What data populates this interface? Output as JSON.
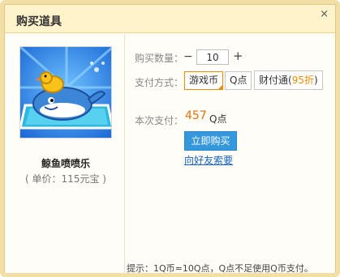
{
  "dialog": {
    "title": "购买道具",
    "close_icon": "close-icon",
    "close_glyph": "×"
  },
  "item": {
    "name": "鲸鱼喷喷乐",
    "price": "( 单价：115元宝 )",
    "image_icon": "whale-duck-image"
  },
  "form": {
    "quantity_label": "购买数量：",
    "quantity_value": "10",
    "minus_glyph": "−",
    "plus_glyph": "+",
    "payment_label": "支付方式：",
    "payment_options": [
      {
        "label": "游戏币",
        "selected": true
      },
      {
        "label": "Q点",
        "selected": false
      },
      {
        "label_prefix": "财付通(",
        "discount": "95折",
        "label_suffix": ")",
        "selected": false
      }
    ],
    "total_label": "本次支付：",
    "total_value": "457",
    "total_unit": "Q点",
    "buy_button": "立即购买",
    "ask_friend_link": "向好友索要"
  },
  "tip": "提示：1Q币=10Q点，Q点不足使用Q币支付。",
  "colors": {
    "accent_orange": "#f28b00",
    "button_blue": "#3598dc",
    "link_blue": "#1a63b8",
    "frame": "#f3dfa6"
  }
}
